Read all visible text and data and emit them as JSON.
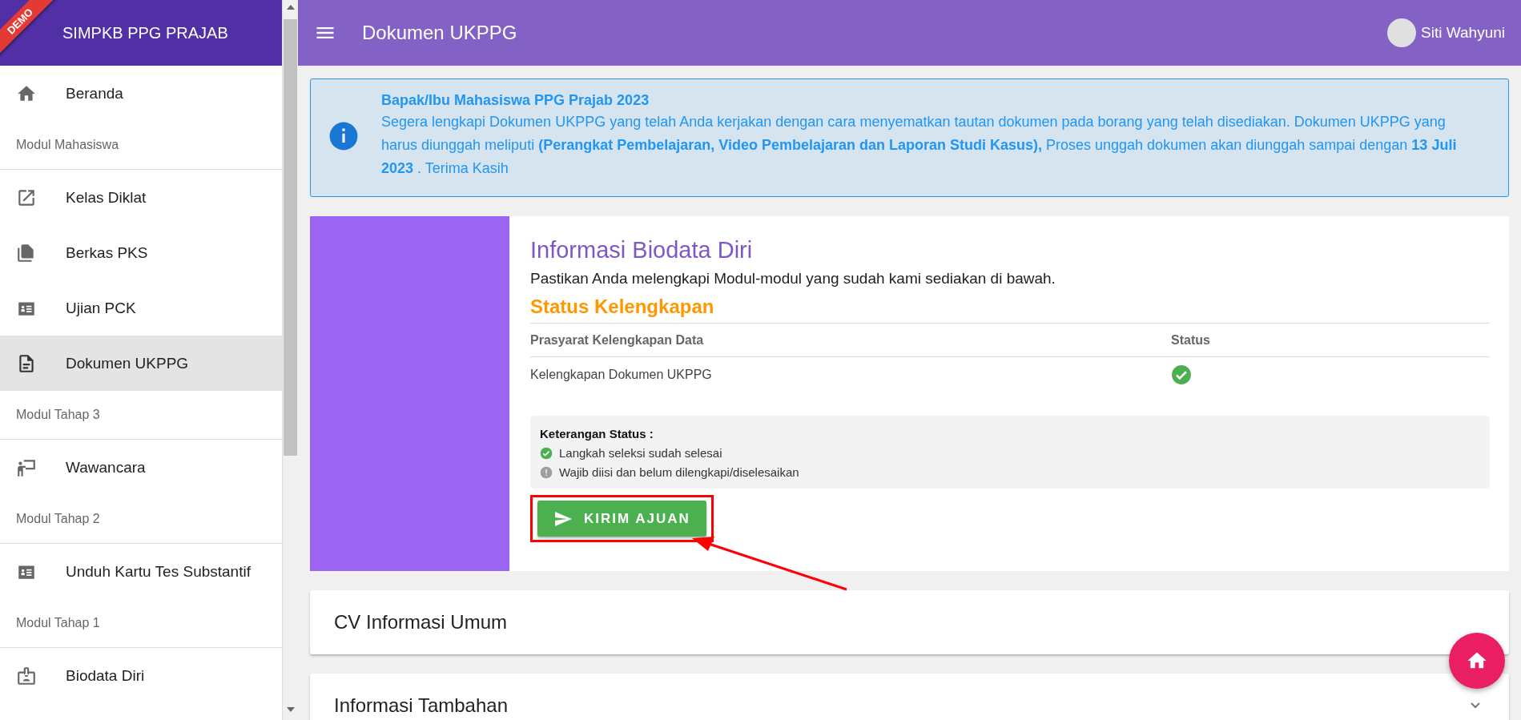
{
  "sidebar": {
    "ribbon": "DEMO",
    "brand": "SIMPKB PPG PRAJAB",
    "items": [
      {
        "kind": "link",
        "label": "Beranda",
        "selected": false
      },
      {
        "kind": "section",
        "label": "Modul Mahasiswa"
      },
      {
        "kind": "link",
        "label": "Kelas Diklat",
        "selected": false
      },
      {
        "kind": "link",
        "label": "Berkas PKS",
        "selected": false
      },
      {
        "kind": "link",
        "label": "Ujian PCK",
        "selected": false
      },
      {
        "kind": "link",
        "label": "Dokumen UKPPG",
        "selected": true
      },
      {
        "kind": "section",
        "label": "Modul Tahap 3"
      },
      {
        "kind": "link",
        "label": "Wawancara",
        "selected": false
      },
      {
        "kind": "section",
        "label": "Modul Tahap 2"
      },
      {
        "kind": "link",
        "label": "Unduh Kartu Tes Substantif",
        "selected": false
      },
      {
        "kind": "section",
        "label": "Modul Tahap 1"
      },
      {
        "kind": "link",
        "label": "Biodata Diri",
        "selected": false
      }
    ]
  },
  "header": {
    "title": "Dokumen UKPPG",
    "user": "Siti Wahyuni"
  },
  "notice": {
    "title": "Bapak/Ibu Mahasiswa PPG Prajab 2023",
    "body": "Segera lengkapi Dokumen UKPPG yang telah Anda kerjakan dengan cara menyematkan tautan dokumen pada borang yang telah disediakan. Dokumen UKPPG yang harus diunggah meliputi **(Perangkat Pembelajaran, Video Pembelajaran dan Laporan Studi Kasus),** Proses unggah dokumen akan diunggah sampai dengan **13 Juli 2023** . Terima Kasih"
  },
  "card": {
    "title": "Informasi Biodata Diri",
    "subtitle": "Pastikan Anda melengkapi Modul-modul yang sudah kami sediakan di bawah.",
    "status_heading": "Status Kelengkapan",
    "columns": [
      "Prasyarat Kelengkapan Data",
      "Status"
    ],
    "rows": [
      {
        "label": "Kelengkapan Dokumen UKPPG",
        "done": true
      }
    ],
    "legend": {
      "title": "Keterangan Status :",
      "items": [
        {
          "kind": "done",
          "label": "Langkah seleksi sudah selesai"
        },
        {
          "kind": "pending",
          "label": "Wajib diisi dan belum dilengkapi/diselesaikan"
        }
      ]
    },
    "button": "KIRIM AJUAN"
  },
  "panels": [
    {
      "title": "CV Informasi Umum",
      "chevron": false
    },
    {
      "title": "Informasi Tambahan",
      "chevron": true
    }
  ]
}
